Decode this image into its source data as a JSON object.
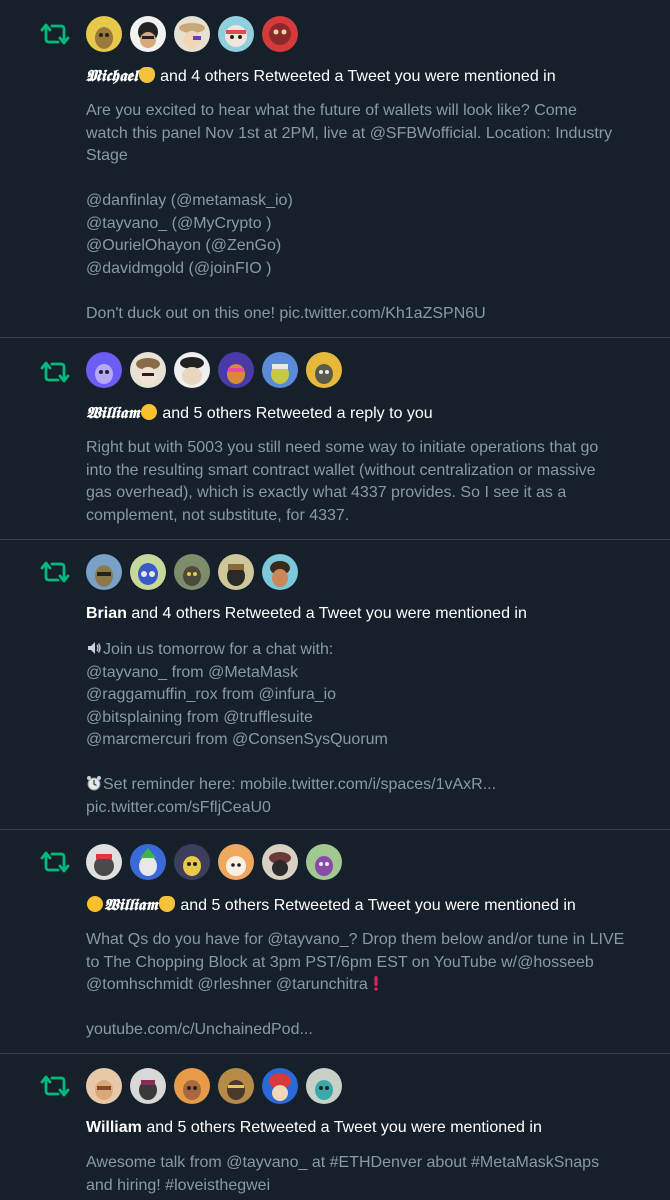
{
  "notifications": [
    {
      "headline_name": "𝕸𝖎𝖈𝖍𝖆𝖊𝖑",
      "headline_rest": "and 4 others Retweeted a Tweet you were mentioned in",
      "avatar_colors": [
        "#e8c84a",
        "#f2f2f2",
        "#e7e1d3",
        "#8fd0dc",
        "#d63a3a"
      ],
      "text_lines": [
        "Are you excited to hear what the future of wallets will look like? Come",
        "watch this panel Nov 1st at 2PM, live at @SFBWofficial. Location: Industry",
        "Stage",
        "",
        "@danfinlay (@metamask_io)",
        "@tayvano_ (@MyCrypto )",
        "@OurielOhayon (@ZenGo)",
        "@davidmgold (@joinFIO )",
        "",
        "Don't duck out on this one! pic.twitter.com/Kh1aZSPN6U"
      ]
    },
    {
      "headline_name": "𝖂𝖎𝖑𝖑𝖎𝖆𝖒",
      "headline_rest": "and 5 others Retweeted a reply to you",
      "avatar_colors": [
        "#6b5ef5",
        "#e8e1d6",
        "#efefef",
        "#4a3aa8",
        "#5a8ad8",
        "#e7b93b"
      ],
      "text_lines": [
        "Right but with 5003 you still need some way to initiate operations that go",
        "into the resulting smart contract wallet (without centralization or massive",
        "gas overhead), which is exactly what 4337 provides. So I see it as a",
        "complement, not substitute, for 4337."
      ]
    },
    {
      "headline_name": "Brian",
      "headline_rest": "and 4 others Retweeted a Tweet you were mentioned in",
      "avatar_colors": [
        "#7aa0c8",
        "#c8d89a",
        "#7d8d6c",
        "#cfc79a",
        "#7cc8d8"
      ],
      "text_lines": [
        "Join us tomorrow for a chat with:",
        "@tayvano_ from @MetaMask",
        "@raggamuffin_rox  from @infura_io",
        "@bitsplaining from @trufflesuite",
        "@marcmercuri from @ConsenSysQuorum",
        "",
        "Set reminder here: mobile.twitter.com/i/spaces/1vAxR...",
        "pic.twitter.com/sFfljCeaU0"
      ]
    },
    {
      "headline_name": "𝖂𝖎𝖑𝖑𝖎𝖆𝖒",
      "headline_rest": "and 5 others Retweeted a Tweet you were mentioned in",
      "avatar_colors": [
        "#e0e0e0",
        "#3a6ad8",
        "#3d3d5c",
        "#f0a860",
        "#d8d0c0",
        "#a0c890"
      ],
      "text_lines": [
        "What Qs do you have for @tayvano_? Drop them below and/or tune in LIVE",
        "to The Chopping Block at 3pm PST/6pm EST on YouTube w/@hosseeb",
        "@tomhschmidt @rleshner @tarunchitra",
        "",
        "youtube.com/c/UnchainedPod..."
      ]
    },
    {
      "headline_name": "William",
      "headline_rest": "and 5 others Retweeted a Tweet you were mentioned in",
      "avatar_colors": [
        "#e8c8a8",
        "#d8d8d8",
        "#e89a48",
        "#b88a48",
        "#2a6ad8",
        "#c8d0c8"
      ],
      "text_lines": [
        "Awesome talk from @tayvano_ at #ETHDenver about #MetaMaskSnaps",
        "and hiring! #loveisthegwei"
      ]
    }
  ],
  "colors": {
    "background": "#15202b",
    "retweet_green": "#00ba7c",
    "secondary_text": "#8b98a5",
    "divider": "#38444d"
  },
  "icons": {
    "retweet": "retweet-icon",
    "speaker": "speaker-icon",
    "alarm_clock": "alarm-clock-icon",
    "exclamation": "red-exclamation-icon"
  }
}
